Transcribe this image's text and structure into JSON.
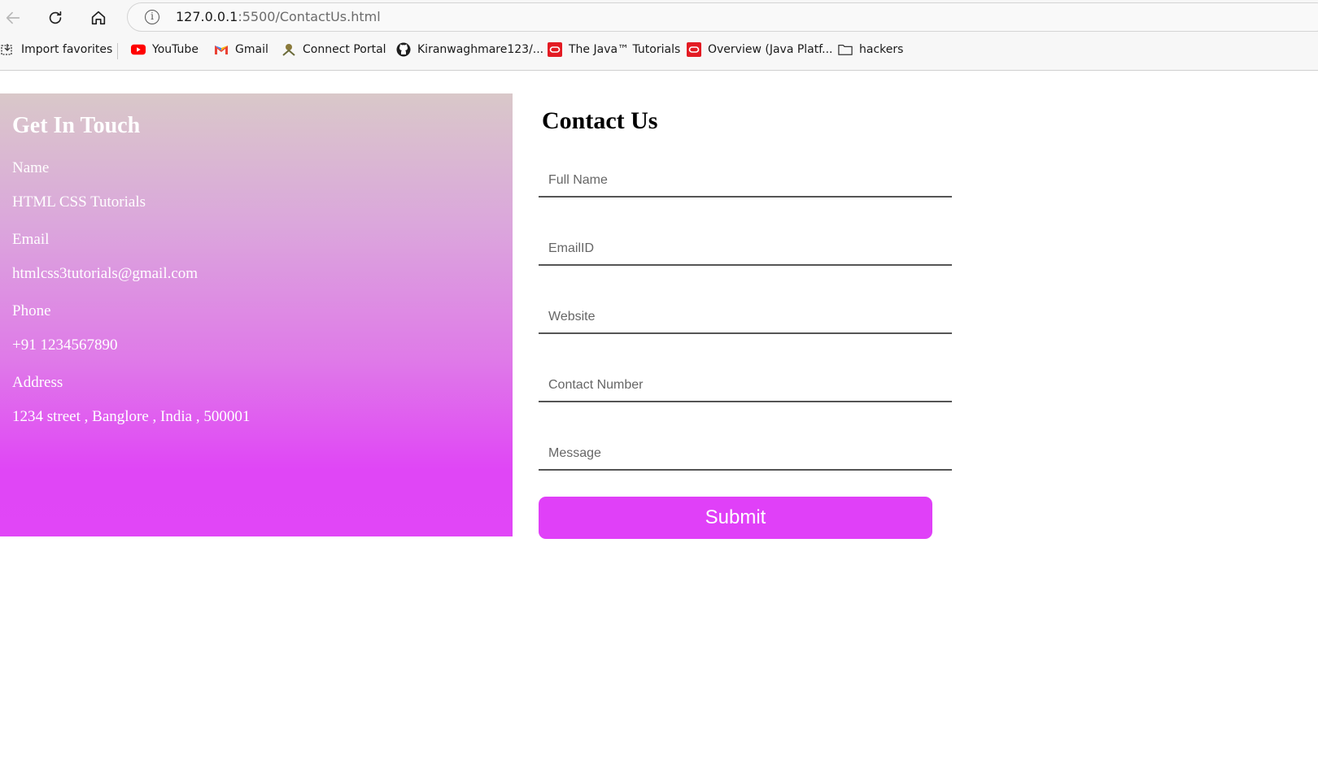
{
  "browser": {
    "url_host": "127.0.0.1",
    "url_rest": ":5500/ContactUs.html",
    "bookmarks": [
      {
        "label": "Import favorites",
        "icon": "import-icon"
      },
      {
        "label": "YouTube",
        "icon": "youtube-icon"
      },
      {
        "label": "Gmail",
        "icon": "gmail-icon"
      },
      {
        "label": "Connect Portal",
        "icon": "connect-portal-icon"
      },
      {
        "label": "Kiranwaghmare123/...",
        "icon": "github-icon"
      },
      {
        "label": "The Java™ Tutorials",
        "icon": "oracle-icon"
      },
      {
        "label": "Overview (Java Platf...",
        "icon": "oracle-icon"
      },
      {
        "label": "hackers",
        "icon": "folder-icon"
      }
    ]
  },
  "contact_info": {
    "title": "Get In Touch",
    "name_label": "Name",
    "name_value": "HTML CSS Tutorials",
    "email_label": "Email",
    "email_value": "htmlcss3tutorials@gmail.com",
    "phone_label": "Phone",
    "phone_value": "+91 1234567890",
    "address_label": "Address",
    "address_value": "1234 street , Banglore , India , 500001"
  },
  "form": {
    "title": "Contact Us",
    "full_name_placeholder": "Full Name",
    "email_placeholder": "EmailID",
    "website_placeholder": "Website",
    "contact_number_placeholder": "Contact Number",
    "message_placeholder": "Message",
    "submit_label": "Submit"
  },
  "colors": {
    "accent": "#e040f8",
    "gradient_top": "#d9c8c9",
    "gradient_bottom": "#e146f7"
  }
}
